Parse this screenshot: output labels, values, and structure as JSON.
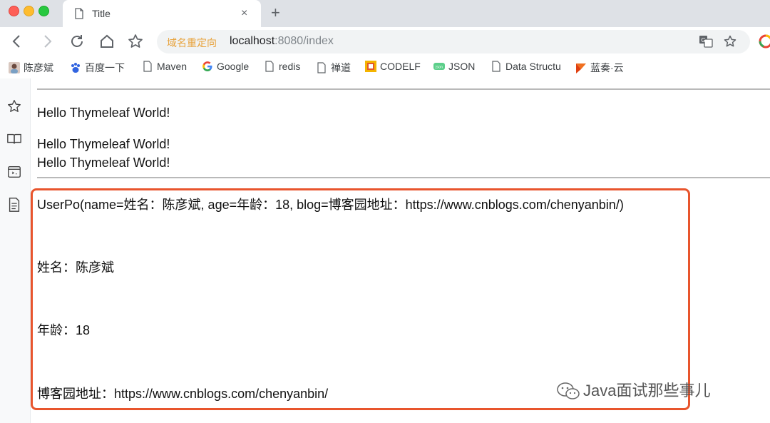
{
  "tab": {
    "title": "Title",
    "close": "×",
    "new_tab": "+"
  },
  "address": {
    "chip": "域名重定向",
    "host": "localhost",
    "port_path": ":8080/index"
  },
  "bookmarks": [
    {
      "label": "陈彦斌",
      "icon": "user-avatar-icon"
    },
    {
      "label": "百度一下",
      "icon": "baidu-paw-icon"
    },
    {
      "label": "Maven",
      "icon": "page-icon"
    },
    {
      "label": "Google",
      "icon": "google-icon"
    },
    {
      "label": "redis",
      "icon": "page-icon"
    },
    {
      "label": "禅道",
      "icon": "page-icon"
    },
    {
      "label": "CODELF",
      "icon": "codelf-icon"
    },
    {
      "label": "JSON",
      "icon": "json-icon"
    },
    {
      "label": "Data Structu",
      "icon": "page-icon"
    },
    {
      "label": "蓝奏·云",
      "icon": "lanzou-icon"
    }
  ],
  "content": {
    "line1": "Hello Thymeleaf World!",
    "line2": "Hello Thymeleaf World!",
    "line3": "Hello Thymeleaf World!",
    "userpo": "UserPo(name=姓名：陈彦斌, age=年龄：18, blog=博客园地址：https://www.cnblogs.com/chenyanbin/)",
    "name": "姓名：陈彦斌",
    "age": "年龄：18",
    "blog": "博客园地址：https://www.cnblogs.com/chenyanbin/"
  },
  "watermark": "Java面试那些事儿",
  "colors": {
    "highlight": "#e8552d",
    "chip": "#e8a33d"
  }
}
